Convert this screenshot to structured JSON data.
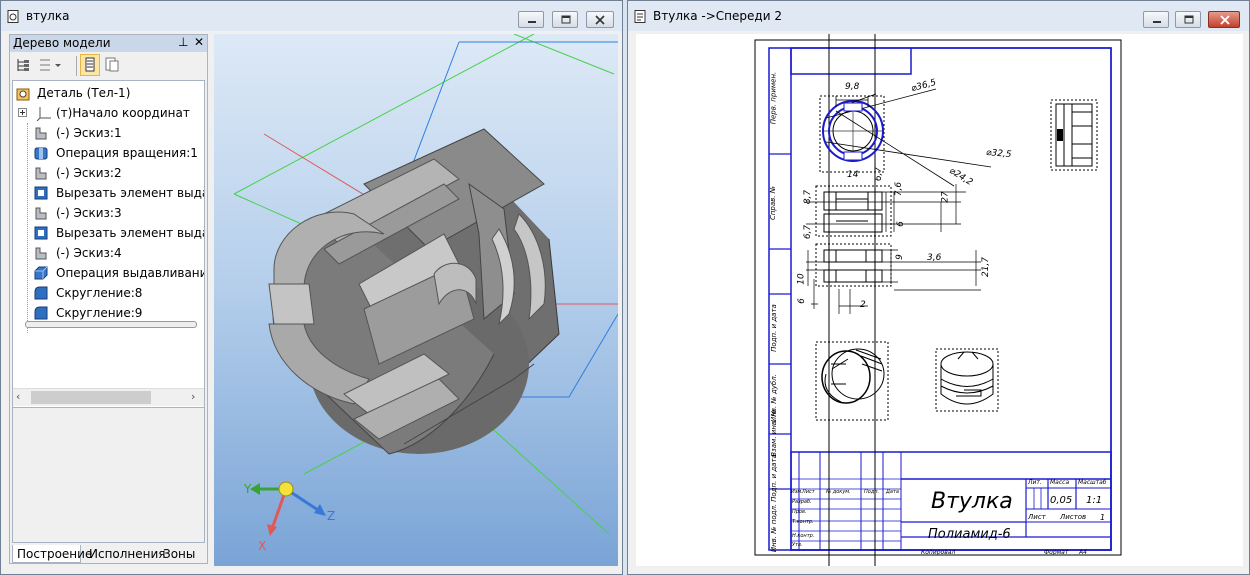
{
  "left_window": {
    "title": "втулка",
    "model_tree_panel": {
      "title": "Дерево модели",
      "pin_glyph": "⊥",
      "close_glyph": "✕",
      "items": [
        {
          "label": "Деталь (Тел-1)",
          "icon": "part-icon"
        },
        {
          "label": "(т)Начало координат",
          "icon": "origin-icon"
        },
        {
          "label": "(-) Эскиз:1",
          "icon": "sketch-icon"
        },
        {
          "label": "Операция вращения:1",
          "icon": "revolve-icon"
        },
        {
          "label": "(-) Эскиз:2",
          "icon": "sketch-icon"
        },
        {
          "label": "Вырезать элемент выдав.",
          "icon": "cut-extrude-icon"
        },
        {
          "label": "(-) Эскиз:3",
          "icon": "sketch-icon"
        },
        {
          "label": "Вырезать элемент выдав.",
          "icon": "cut-extrude-icon"
        },
        {
          "label": "(-) Эскиз:4",
          "icon": "sketch-icon"
        },
        {
          "label": "Операция выдавливания",
          "icon": "extrude-icon"
        },
        {
          "label": "Скругление:8",
          "icon": "fillet-icon"
        },
        {
          "label": "Скругление:9",
          "icon": "fillet-icon"
        }
      ],
      "tabs": [
        "Построение",
        "Исполнения",
        "Зоны"
      ],
      "active_tab": "Построение"
    },
    "viewport": {
      "axes": {
        "x": "X",
        "y": "Y",
        "z": "Z"
      }
    }
  },
  "right_window": {
    "title": "Втулка ->Спереди 2",
    "drawing": {
      "dimensions": [
        "9,8",
        "⌀36,5",
        "⌀32,5",
        "⌀24,2",
        "14",
        "6,7",
        "7,6",
        "8,7",
        "27",
        "6",
        "6,7",
        "9",
        "3,6",
        "21,7",
        "10",
        "6",
        "2"
      ],
      "side_labels": [
        "Перв. примен.",
        "Справ. №",
        "Подп. и дата",
        "Инв. № дубл.",
        "Взам. инв. №",
        "Подп. и дата",
        "Инв. № подл."
      ],
      "title_block": {
        "name": "Втулка",
        "material": "Полиамид-6",
        "lit_header": "Лит.",
        "mass_header": "Масса",
        "scale_header": "Масштаб",
        "mass": "0,05",
        "scale": "1:1",
        "sheet": "Лист",
        "sheets": "Листов",
        "sheets_count": "1",
        "copied": "Копировал",
        "format": "Формат",
        "format_value": "А4",
        "roles": [
          "Изм.",
          "Лист",
          "№ докум.",
          "Подп.",
          "Дата",
          "Разраб.",
          "Пров.",
          "Т.контр.",
          "Н.контр.",
          "Утв."
        ]
      }
    }
  },
  "colors": {
    "titlebar": "#dfe8f3",
    "viewport_top": "#dbe8f6",
    "viewport_bottom": "#7aa4d6",
    "frame_blue": "#1a1ad0",
    "part_gray": "#7a7a7a"
  }
}
